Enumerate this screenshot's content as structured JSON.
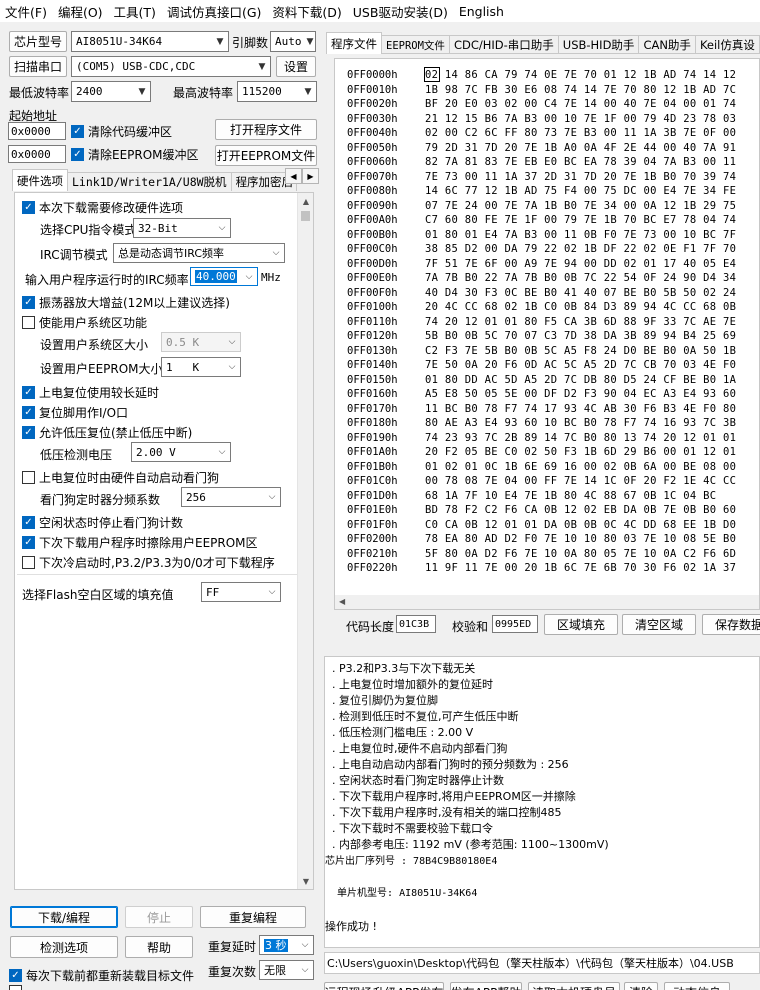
{
  "menu": [
    "文件(F)",
    "编程(O)",
    "工具(T)",
    "调试仿真接口(G)",
    "资料下载(D)",
    "USB驱动安装(D)",
    "English"
  ],
  "chip": {
    "label": "芯片型号",
    "value": "AI8051U-34K64",
    "data_width_label": "引脚数",
    "data_width_value": "Auto"
  },
  "port": {
    "label": "扫描串口",
    "value": "(COM5) USB-CDC,CDC",
    "settings": "设置"
  },
  "baud": {
    "min_label": "最低波特率",
    "min_value": "2400",
    "max_label": "最高波特率",
    "max_value": "115200"
  },
  "start_addr": {
    "label": "起始地址",
    "code_addr": "0x0000",
    "code_clear": "清除代码缓冲区",
    "eeprom_addr": "0x0000",
    "eeprom_clear": "清除EEPROM缓冲区",
    "open_prog": "打开程序文件",
    "open_eeprom": "打开EEPROM文件"
  },
  "left_tabs": [
    "硬件选项",
    "Link1D/Writer1A/U8W脱机",
    "程序加密后"
  ],
  "options": {
    "modify_hw": "本次下载需要修改硬件选项",
    "cpu_label": "选择CPU指令模式",
    "cpu_value": "32-Bit",
    "irc_label": "IRC调节模式",
    "irc_value": "总是动态调节IRC频率",
    "freq_label": "输入用户程序运行时的IRC频率",
    "freq_value": "40.000",
    "freq_unit": "MHz",
    "osc_gain": "振荡器放大增益(12M以上建议选择)",
    "user_sys": "使能用户系统区功能",
    "user_sys_size_label": "设置用户系统区大小",
    "user_sys_size_value": "0.5 K",
    "eeprom_size_label": "设置用户EEPROM大小",
    "eeprom_size_value": "1   K",
    "por_delay": "上电复位使用较长延时",
    "reset_io": "复位脚用作I/O口",
    "lvr": "允许低压复位(禁止低压中断)",
    "lvd_label": "低压检测电压",
    "lvd_value": "2.00 V",
    "wdt_auto": "上电复位时由硬件自动启动看门狗",
    "wdt_div_label": "看门狗定时器分频系数",
    "wdt_div_value": "256",
    "idle_wdt": "空闲状态时停止看门狗计数",
    "erase_eeprom": "下次下载用户程序时擦除用户EEPROM区",
    "p32p33": "下次冷启动时,P3.2/P3.3为0/0才可下载程序",
    "fill_label": "选择Flash空白区域的填充值",
    "fill_value": "FF"
  },
  "bottom_left": {
    "download": "下载/编程",
    "stop": "停止",
    "reprogram": "重复编程",
    "detect": "检测选项",
    "help": "帮助",
    "delay_label": "重复延时",
    "delay_value": "3 秒",
    "reload": "每次下载前都重新装载目标文件",
    "count_label": "重复次数",
    "count_value": "无限"
  },
  "right_tabs": [
    "程序文件",
    "EEPROM文件",
    "CDC/HID-串口助手",
    "USB-HID助手",
    "CAN助手",
    "Keil仿真设"
  ],
  "hex_rows": [
    [
      "0FF0000h",
      "02 14 86 CA 79 74 0E 7E 70 01 12 1B AD 74 14 12"
    ],
    [
      "0FF0010h",
      "1B 98 7C FB 30 E6 08 74 14 7E 70 80 12 1B AD 7C"
    ],
    [
      "0FF0020h",
      "BF 20 E0 03 02 00 C4 7E 14 00 40 7E 04 00 01 74"
    ],
    [
      "0FF0030h",
      "21 12 15 B6 7A B3 00 10 7E 1F 00 79 4D 23 78 03"
    ],
    [
      "0FF0040h",
      "02 00 C2 6C FF 80 73 7E B3 00 11 1A 3B 7E 0F 00"
    ],
    [
      "0FF0050h",
      "79 2D 31 7D 20 7E 1B A0 0A 4F 2E 44 00 40 7A 91"
    ],
    [
      "0FF0060h",
      "82 7A 81 83 7E EB E0 BC EA 78 39 04 7A B3 00 11"
    ],
    [
      "0FF0070h",
      "7E 73 00 11 1A 37 2D 31 7D 20 7E 1B B0 70 39 74"
    ],
    [
      "0FF0080h",
      "14 6C 77 12 1B AD 75 F4 00 75 DC 00 E4 7E 34 FE"
    ],
    [
      "0FF0090h",
      "07 7E 24 00 7E 7A 1B B0 7E 34 00 0A 12 1B 29 75"
    ],
    [
      "0FF00A0h",
      "C7 60 80 FE 7E 1F 00 79 7E 1B 70 BC E7 78 04 74"
    ],
    [
      "0FF00B0h",
      "01 80 01 E4 7A B3 00 11 0B F0 7E 73 00 10 BC 7F"
    ],
    [
      "0FF00C0h",
      "38 85 D2 00 DA 79 22 02 1B DF 22 02 0E F1 7F 70"
    ],
    [
      "0FF00D0h",
      "7F 51 7E 6F 00 A9 7E 94 00 DD 02 01 17 40 05 E4"
    ],
    [
      "0FF00E0h",
      "7A 7B B0 22 7A 7B B0 0B 7C 22 54 0F 24 90 D4 34"
    ],
    [
      "0FF00F0h",
      "40 D4 30 F3 0C BE B0 41 40 07 BE B0 5B 50 02 24"
    ],
    [
      "0FF0100h",
      "20 4C CC 68 02 1B C0 0B 84 D3 89 94 4C CC 68 0B"
    ],
    [
      "0FF0110h",
      "74 20 12 01 01 80 F5 CA 3B 6D 88 9F 33 7C AE 7E"
    ],
    [
      "0FF0120h",
      "5B B0 0B 5C 70 07 C3 7D 38 DA 3B 89 94 B4 25 69"
    ],
    [
      "0FF0130h",
      "C2 F3 7E 5B B0 0B 5C A5 F8 24 D0 BE B0 0A 50 1B"
    ],
    [
      "0FF0140h",
      "7E 50 0A 20 F6 0D AC 5C A5 2D 7C CB 70 03 4E F0"
    ],
    [
      "0FF0150h",
      "01 80 DD AC 5D A5 2D 7C DB 80 D5 24 CF BE B0 1A"
    ],
    [
      "0FF0160h",
      "A5 E8 50 05 5E 00 DF D2 F3 90 04 EC A3 E4 93 60"
    ],
    [
      "0FF0170h",
      "11 BC B0 78 F7 74 17 93 4C AB 30 F6 B3 4E F0 80"
    ],
    [
      "0FF0180h",
      "80 AE A3 E4 93 60 10 BC B0 78 F7 74 16 93 7C 3B"
    ],
    [
      "0FF0190h",
      "74 23 93 7C 2B 89 14 7C B0 80 13 74 20 12 01 01"
    ],
    [
      "0FF01A0h",
      "20 F2 05 BE C0 02 50 F3 1B 6D 29 B6 00 01 12 01"
    ],
    [
      "0FF01B0h",
      "01 02 01 0C 1B 6E 69 16 00 02 0B 6A 00 BE 08 00"
    ],
    [
      "0FF01C0h",
      "00 78 08 7E 04 00 FF 7E 14 1C 0F 20 F2 1E 4C CC"
    ],
    [
      "0FF01D0h",
      "68 1A 7F 10 E4 7E 1B 80 4C 88 67 0B 1C 04 BC"
    ],
    [
      "0FF01E0h",
      "BD 78 F2 C2 F6 CA 0B 12 02 EB DA 0B 7E 0B B0 60"
    ],
    [
      "0FF01F0h",
      "C0 CA 0B 12 01 01 DA 0B 0B 0C 4C DD 68 EE 1B D0"
    ],
    [
      "0FF0200h",
      "78 EA 80 AD D2 F0 7E 10 10 80 03 7E 10 08 5E B0"
    ],
    [
      "0FF0210h",
      "5F 80 0A D2 F6 7E 10 0A 80 05 7E 10 0A C2 F6 6D"
    ],
    [
      "0FF0220h",
      "11 9F 11 7E 00 20 1B 6C 7E 6B 70 30 F6 02 1A 37"
    ]
  ],
  "hex_footer": {
    "len_label": "代码长度",
    "len_value": "01C3B",
    "sum_label": "校验和",
    "sum_value": "0995ED",
    "fill": "区域填充",
    "clear": "清空区域",
    "save": "保存数据"
  },
  "log_lines": [
    "  . P3.2和P3.3与下次下载无关",
    "  . 上电复位时增加额外的复位延时",
    "  . 复位引脚仍为复位脚",
    "  . 检测到低压时不复位,可产生低压中断",
    "  . 低压检测门槛电压 : 2.00 V",
    "  . 上电复位时,硬件不启动内部看门狗",
    "  . 上电自动启动内部看门狗时的预分频数为 : 256",
    "  . 空闲状态时看门狗定时器停止计数",
    "  . 下次下载用户程序时,将用户EEPROM区一并擦除",
    "  . 下次下载用户程序时,没有相关的端口控制485",
    "  . 下次下载时不需要校验下载口令",
    "  . 内部参考电压: 1192 mV (参考范围: 1100~1300mV)",
    "芯片出厂序列号 : 78B4C9B80180E4",
    "",
    "  单片机型号: AI8051U-34K64",
    "",
    "操作成功 !"
  ],
  "path": "C:\\Users\\guoxin\\Desktop\\代码包（擎天柱版本）\\代码包（擎天柱版本）\\04.USB",
  "bottom_right_buttons": [
    "远程现场升级APP发布",
    "发布APP帮助",
    "读取本机硬盘号",
    "清除",
    "动态信息"
  ]
}
